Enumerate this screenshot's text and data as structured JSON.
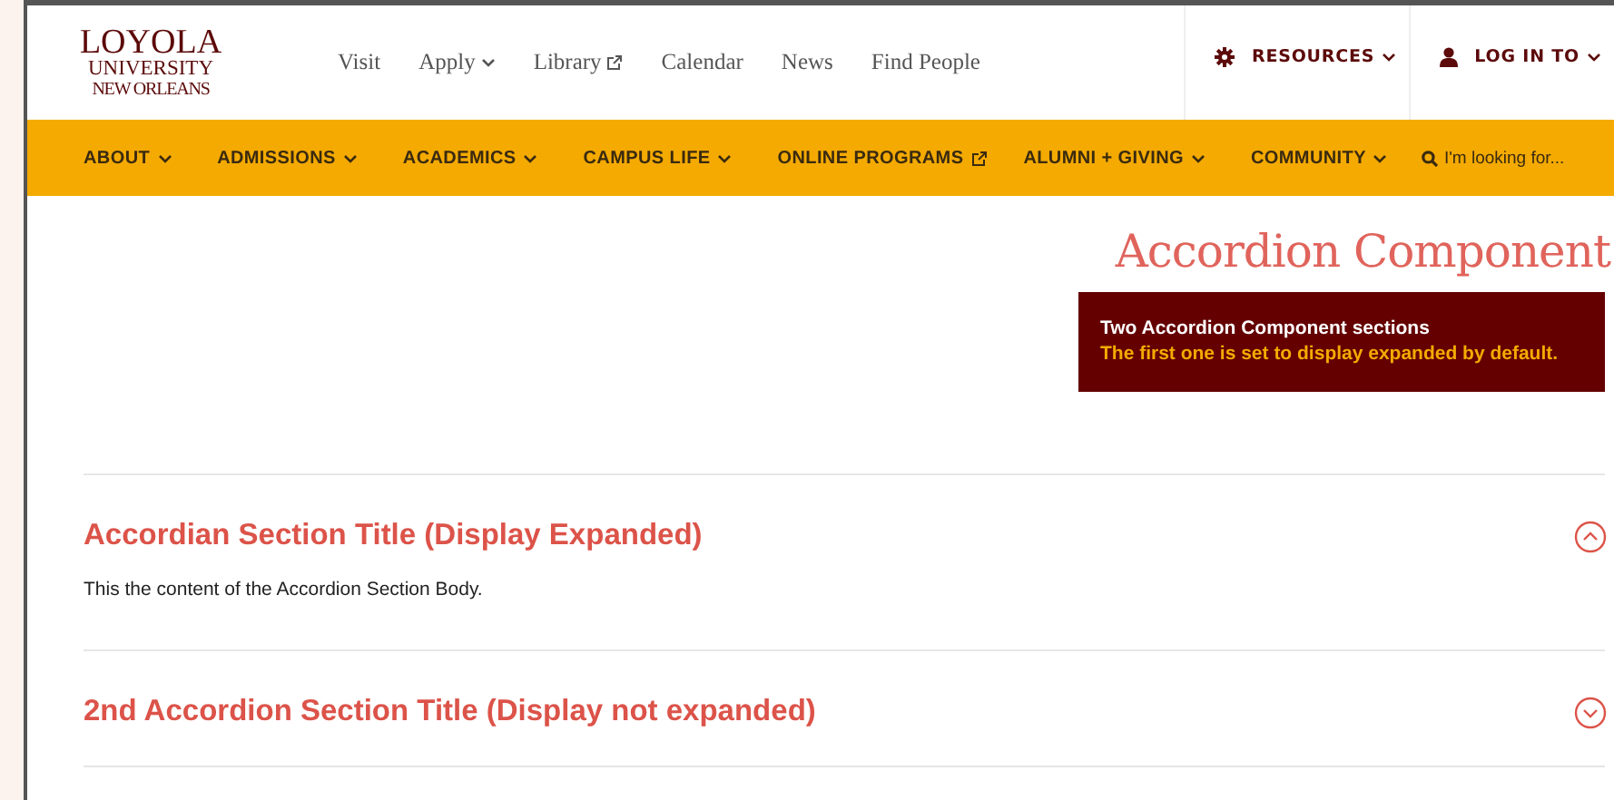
{
  "logo": {
    "lines": [
      "LOYOLA",
      "UNIVERSITY",
      "NEW ORLEANS"
    ]
  },
  "utility_links": [
    {
      "label": "Visit",
      "kind": "plain"
    },
    {
      "label": "Apply",
      "kind": "dropdown"
    },
    {
      "label": "Library",
      "kind": "external"
    },
    {
      "label": "Calendar",
      "kind": "plain"
    },
    {
      "label": "News",
      "kind": "plain"
    },
    {
      "label": "Find People",
      "kind": "plain"
    }
  ],
  "account_menus": [
    {
      "label": "RESOURCES",
      "kind": "gear"
    },
    {
      "label": "LOG IN TO",
      "kind": "person"
    }
  ],
  "main_nav": [
    {
      "label": "ABOUT",
      "kind": "dropdown"
    },
    {
      "label": "ADMISSIONS",
      "kind": "dropdown"
    },
    {
      "label": "ACADEMICS",
      "kind": "dropdown"
    },
    {
      "label": "CAMPUS LIFE",
      "kind": "dropdown"
    },
    {
      "label": "ONLINE PROGRAMS",
      "kind": "external"
    },
    {
      "label": "ALUMNI + GIVING",
      "kind": "dropdown"
    },
    {
      "label": "COMMUNITY",
      "kind": "dropdown"
    }
  ],
  "search": {
    "placeholder": "I'm looking for..."
  },
  "page_title": "Accordion Component",
  "notice": {
    "heading": "Two Accordion Component sections",
    "text": "The first one is set to display expanded by default."
  },
  "accordion": [
    {
      "title": "Accordian Section Title (Display Expanded)",
      "expanded": true,
      "body": "This the content of the Accordion Section Body."
    },
    {
      "title": "2nd Accordion Section Title (Display not expanded)",
      "expanded": false
    }
  ]
}
